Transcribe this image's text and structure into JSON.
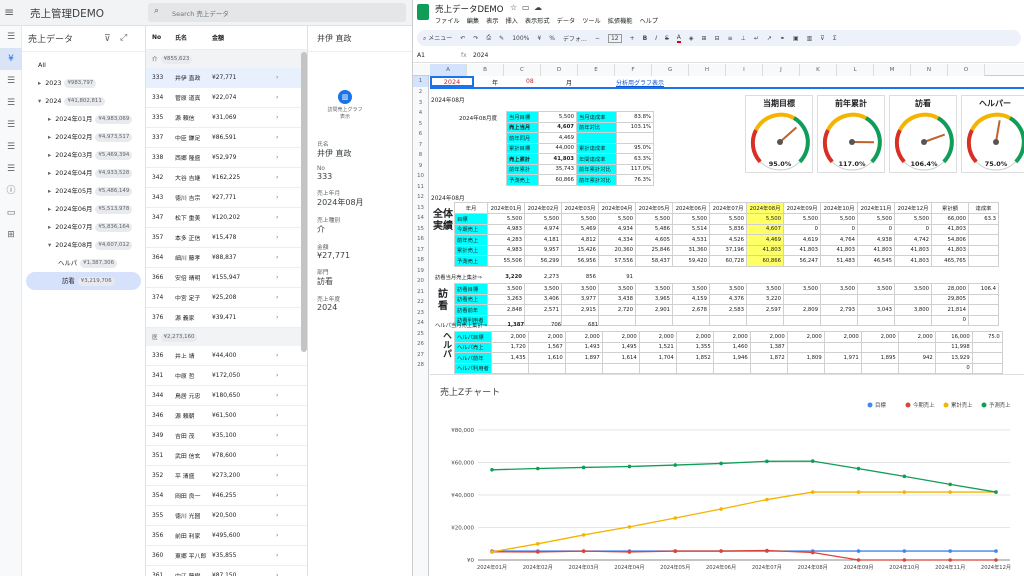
{
  "app": {
    "title": "売上管理DEMO",
    "search_placeholder": "Search 売上データ",
    "section_title": "売上データ",
    "detail_name_header": "井伊 直政"
  },
  "tree": {
    "all": "All",
    "years": [
      {
        "label": "2023",
        "total": "¥983,797",
        "expanded": false
      },
      {
        "label": "2024",
        "total": "¥41,802,811",
        "expanded": true
      }
    ],
    "months": [
      {
        "label": "2024年01月",
        "total": "¥4,983,069"
      },
      {
        "label": "2024年02月",
        "total": "¥4,973,517"
      },
      {
        "label": "2024年03月",
        "total": "¥5,469,394"
      },
      {
        "label": "2024年04月",
        "total": "¥4,933,528"
      },
      {
        "label": "2024年05月",
        "total": "¥5,486,149"
      },
      {
        "label": "2024年06月",
        "total": "¥5,513,978"
      },
      {
        "label": "2024年07月",
        "total": "¥5,836,164"
      },
      {
        "label": "2024年08月",
        "total": "¥4,607,012"
      }
    ],
    "types": [
      {
        "label": "ヘルパ",
        "total": "¥1,387,306"
      },
      {
        "label": "訪看",
        "total": "¥3,219,706",
        "selected": true
      }
    ]
  },
  "list": {
    "headers": [
      "No",
      "氏名",
      "金額"
    ],
    "group1": {
      "label": "介",
      "total": "¥855,623"
    },
    "rows1": [
      [
        "333",
        "井伊 直政",
        "¥27,771"
      ],
      [
        "334",
        "菅原 道真",
        "¥22,074"
      ],
      [
        "335",
        "源 頼信",
        "¥31,069"
      ],
      [
        "337",
        "中臣 鎌足",
        "¥86,591"
      ],
      [
        "338",
        "西郷 隆盛",
        "¥52,979"
      ],
      [
        "342",
        "大谷 吉継",
        "¥162,225"
      ],
      [
        "343",
        "徳川 吉宗",
        "¥27,771"
      ],
      [
        "347",
        "松下 重美",
        "¥120,202"
      ],
      [
        "357",
        "本多 正信",
        "¥15,478"
      ],
      [
        "364",
        "細川 藤孝",
        "¥88,837"
      ],
      [
        "366",
        "安倍 晴明",
        "¥155,947"
      ],
      [
        "374",
        "中宮 定子",
        "¥25,208"
      ],
      [
        "376",
        "源 義家",
        "¥39,471"
      ]
    ],
    "group2": {
      "label": "医",
      "total": "¥2,273,160"
    },
    "rows2": [
      [
        "336",
        "井上 靖",
        "¥44,400"
      ],
      [
        "341",
        "中原 哲",
        "¥172,050"
      ],
      [
        "344",
        "鳥居 元忠",
        "¥180,650"
      ],
      [
        "346",
        "源 頼朝",
        "¥61,500"
      ],
      [
        "349",
        "吉田 茂",
        "¥35,100"
      ],
      [
        "351",
        "武田 信玄",
        "¥78,600"
      ],
      [
        "352",
        "平 清盛",
        "¥273,200"
      ],
      [
        "354",
        "岡田 良一",
        "¥46,255"
      ],
      [
        "355",
        "徳川 光圀",
        "¥20,500"
      ],
      [
        "356",
        "前田 利家",
        "¥495,600"
      ],
      [
        "360",
        "東郷 平八郎",
        "¥35,855"
      ],
      [
        "361",
        "中江 藤樹",
        "¥87,150"
      ]
    ]
  },
  "detail": {
    "chart_button": "訪問売上グラフ表示",
    "fields": [
      {
        "label": "氏名",
        "value": "井伊 直政"
      },
      {
        "label": "No",
        "value": "333"
      },
      {
        "label": "売上年月",
        "value": "2024年08月"
      },
      {
        "label": "売上種別",
        "value": "介"
      },
      {
        "label": "金額",
        "value": "¥27,771"
      },
      {
        "label": "部門",
        "value": "訪看"
      },
      {
        "label": "売上年度",
        "value": "2024"
      }
    ]
  },
  "sheet": {
    "title": "売上データDEMO",
    "menus": [
      "ファイル",
      "編集",
      "表示",
      "挿入",
      "表示形式",
      "データ",
      "ツール",
      "拡張機能",
      "ヘルプ"
    ],
    "menu_search": "メニュー",
    "zoom": "100%",
    "font": "デフォ…",
    "font_size": "12",
    "cell_ref": "A1",
    "formula": "2024",
    "cols": [
      "A",
      "B",
      "C",
      "D",
      "E",
      "F",
      "G",
      "H",
      "I",
      "J",
      "K",
      "L",
      "M",
      "N",
      "O"
    ],
    "row1": {
      "year": "2024",
      "nen": "年",
      "month": "08",
      "tsuki": "月",
      "link": "分析用グラフ表示"
    },
    "date_label": "2024年08月",
    "period_label": "2024年08月度",
    "kpi": [
      [
        "当月目標",
        "5,500",
        "当月達成率",
        "83.8%"
      ],
      [
        "売上当月",
        "4,607",
        "前年対比",
        "103.1%"
      ],
      [
        "前年同月",
        "4,469",
        "",
        ""
      ],
      [
        "累計目標",
        "44,000",
        "累計達成率",
        "95.0%"
      ],
      [
        "売上累計",
        "41,803",
        "年間達成率",
        "63.3%"
      ],
      [
        "前年累計",
        "35,743",
        "前年累計対比",
        "117.0%"
      ],
      [
        "予測売上",
        "60,866",
        "前年累計対比",
        "76.3%"
      ]
    ],
    "gauges": [
      {
        "title": "当期目標",
        "value": "95.0%",
        "v": 0.95
      },
      {
        "title": "前年累計",
        "value": "117.0%",
        "v": 1.17
      },
      {
        "title": "訪看",
        "value": "106.4%",
        "v": 1.064
      },
      {
        "title": "ヘルパー",
        "value": "75.0%",
        "v": 0.75
      }
    ],
    "months": [
      "2024年01月",
      "2024年02月",
      "2024年03月",
      "2024年04月",
      "2024年05月",
      "2024年06月",
      "2024年07月",
      "2024年08月",
      "2024年09月",
      "2024年10月",
      "2024年11月",
      "2024年12月"
    ],
    "sec_all": "全体実績",
    "sec_houkan": "訪看",
    "sec_helper": "ヘルパ",
    "all_rows": [
      [
        "目標",
        "5,500",
        "5,500",
        "5,500",
        "5,500",
        "5,500",
        "5,500",
        "5,500",
        "5,500",
        "5,500",
        "5,500",
        "5,500",
        "5,500",
        "66,000",
        "63.3"
      ],
      [
        "今期売上",
        "4,983",
        "4,974",
        "5,469",
        "4,934",
        "5,486",
        "5,514",
        "5,836",
        "4,607",
        "0",
        "0",
        "0",
        "0",
        "41,803",
        ""
      ],
      [
        "前年売上",
        "4,283",
        "4,181",
        "4,812",
        "4,334",
        "4,605",
        "4,531",
        "4,526",
        "4,469",
        "4,619",
        "4,764",
        "4,938",
        "4,742",
        "54,806",
        ""
      ],
      [
        "累計売上",
        "4,983",
        "9,957",
        "15,426",
        "20,360",
        "25,846",
        "31,360",
        "37,196",
        "41,803",
        "41,803",
        "41,803",
        "41,803",
        "41,803",
        "41,803",
        ""
      ],
      [
        "予測売上",
        "55,506",
        "56,299",
        "56,956",
        "57,556",
        "58,437",
        "59,420",
        "60,728",
        "60,866",
        "56,247",
        "51,483",
        "46,545",
        "41,803",
        "465,765",
        ""
      ]
    ],
    "h_summary": [
      "訪看当月売上集計⇒",
      "3,220",
      "2,273",
      "856",
      "91"
    ],
    "h_rows": [
      [
        "訪看目標",
        "3,500",
        "3,500",
        "3,500",
        "3,500",
        "3,500",
        "3,500",
        "3,500",
        "3,500",
        "3,500",
        "3,500",
        "3,500",
        "3,500",
        "28,000",
        "106.4"
      ],
      [
        "訪看売上",
        "3,263",
        "3,406",
        "3,977",
        "3,438",
        "3,965",
        "4,159",
        "4,376",
        "3,220",
        "",
        "",
        "",
        "",
        "29,805",
        ""
      ],
      [
        "訪看前年",
        "2,848",
        "2,571",
        "2,915",
        "2,720",
        "2,901",
        "2,678",
        "2,583",
        "2,597",
        "2,809",
        "2,793",
        "3,043",
        "3,800",
        "21,814",
        ""
      ],
      [
        "訪看利用者",
        "",
        "",
        "",
        "",
        "",
        "",
        "",
        "",
        "",
        "",
        "",
        "",
        "0",
        ""
      ]
    ],
    "p_summary": [
      "ヘルパ当月売上集計⇒",
      "1,387",
      "706",
      "681"
    ],
    "p_rows": [
      [
        "ヘルパ目標",
        "2,000",
        "2,000",
        "2,000",
        "2,000",
        "2,000",
        "2,000",
        "2,000",
        "2,000",
        "2,000",
        "2,000",
        "2,000",
        "2,000",
        "16,000",
        "75.0"
      ],
      [
        "ヘルパ売上",
        "1,720",
        "1,567",
        "1,493",
        "1,495",
        "1,521",
        "1,355",
        "1,460",
        "1,387",
        "",
        "",
        "",
        "",
        "11,998",
        ""
      ],
      [
        "ヘルパ前年",
        "1,435",
        "1,610",
        "1,897",
        "1,614",
        "1,704",
        "1,852",
        "1,946",
        "1,872",
        "1,809",
        "1,971",
        "1,895",
        "942",
        "13,929",
        ""
      ],
      [
        "ヘルパ利用者",
        "",
        "",
        "",
        "",
        "",
        "",
        "",
        "",
        "",
        "",
        "",
        "",
        "0",
        ""
      ]
    ]
  },
  "chart_data": {
    "type": "line",
    "title": "売上Zチャート",
    "categories": [
      "2024年01月",
      "2024年02月",
      "2024年03月",
      "2024年04月",
      "2024年05月",
      "2024年06月",
      "2024年07月",
      "2024年08月",
      "2024年09月",
      "2024年10月",
      "2024年11月",
      "2024年12月"
    ],
    "series": [
      {
        "name": "目標",
        "color": "#4285f4",
        "values": [
          5500,
          5500,
          5500,
          5500,
          5500,
          5500,
          5500,
          5500,
          5500,
          5500,
          5500,
          5500
        ]
      },
      {
        "name": "今期売上",
        "color": "#db4437",
        "values": [
          4983,
          4974,
          5469,
          4934,
          5486,
          5514,
          5836,
          4607,
          0,
          0,
          0,
          0
        ]
      },
      {
        "name": "累計売上",
        "color": "#f4b400",
        "values": [
          4983,
          9957,
          15426,
          20360,
          25846,
          31360,
          37196,
          41803,
          41803,
          41803,
          41803,
          41803
        ]
      },
      {
        "name": "予測売上",
        "color": "#0f9d58",
        "values": [
          55506,
          56299,
          56956,
          57556,
          58437,
          59420,
          60728,
          60866,
          56247,
          51483,
          46545,
          41803
        ]
      }
    ],
    "ylim": [
      0,
      80000
    ],
    "yticks": [
      "¥0",
      "¥20,000",
      "¥40,000",
      "¥60,000",
      "¥80,000"
    ],
    "legend": "top-right",
    "grid": true
  }
}
